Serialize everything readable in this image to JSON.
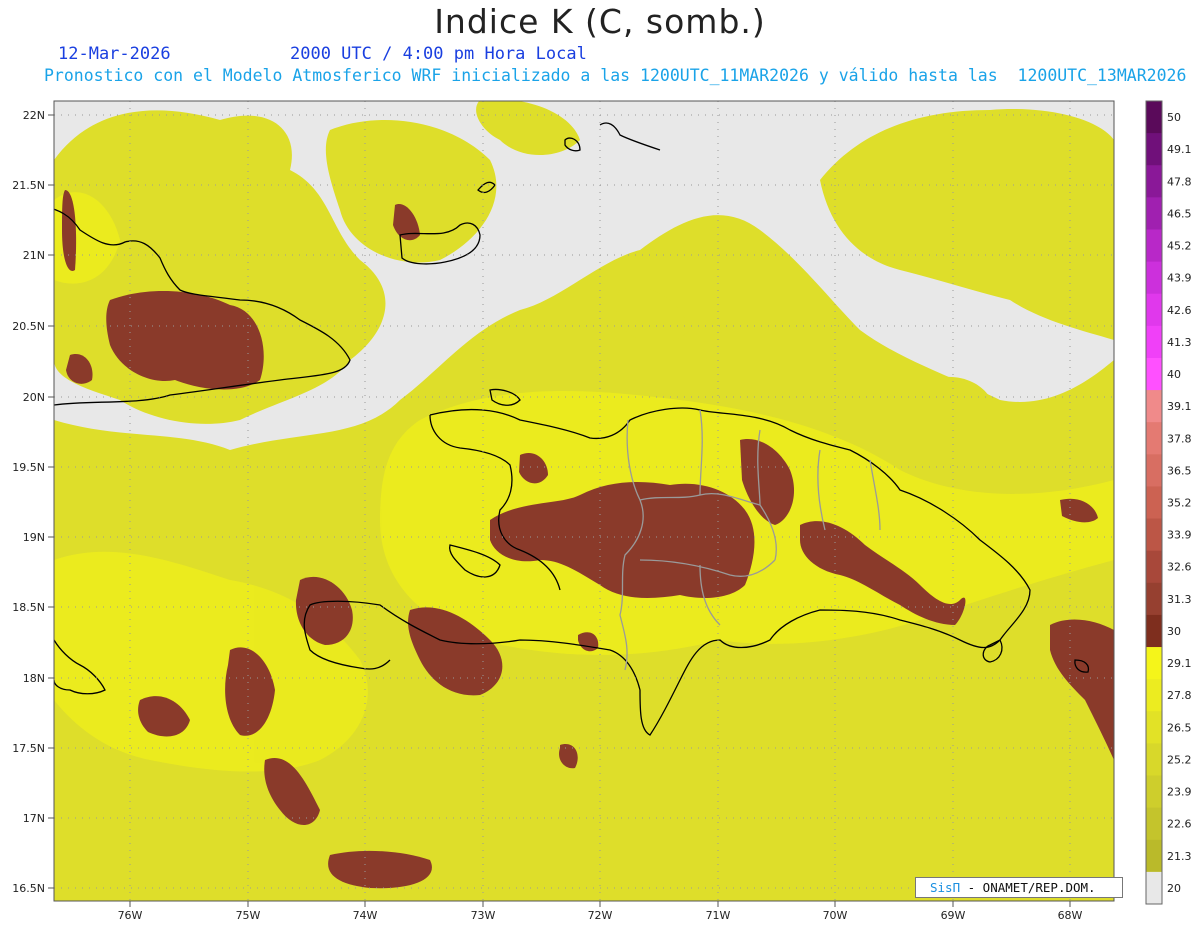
{
  "header": {
    "title": "Indice K (C, somb.)",
    "date": "12-Mar-2026",
    "time": "2000 UTC / 4:00 pm Hora Local",
    "subtitle": "Pronostico con el Modelo Atmosferico WRF inicializado a las 1200UTC_11MAR2026 y válido hasta las  1200UTC_13MAR2026"
  },
  "map": {
    "lat_labels": [
      "22N",
      "21.5N",
      "21N",
      "20.5N",
      "20N",
      "19.5N",
      "19N",
      "18.5N",
      "18N",
      "17.5N",
      "17N",
      "16.5N"
    ],
    "lon_labels": [
      "76W",
      "75W",
      "74W",
      "73W",
      "72W",
      "71W",
      "70W",
      "69W",
      "68W"
    ],
    "background_color": "#e8e8e8",
    "coastline_color": "#000000",
    "border_color": "#9a9a9a"
  },
  "colorbar": {
    "ticks": [
      "50",
      "49.1",
      "47.8",
      "46.5",
      "45.2",
      "43.9",
      "42.6",
      "41.3",
      "40",
      "39.1",
      "37.8",
      "36.5",
      "35.2",
      "33.9",
      "32.6",
      "31.3",
      "30",
      "29.1",
      "27.8",
      "26.5",
      "25.2",
      "23.9",
      "22.6",
      "21.3",
      "20"
    ],
    "colors": [
      "#5a0a5a",
      "#70107a",
      "#8a1898",
      "#a020b0",
      "#b828c8",
      "#cc30dc",
      "#e038ec",
      "#f040f8",
      "#ff50ff",
      "#f08a8a",
      "#e47a72",
      "#d86e62",
      "#cc6252",
      "#bc5646",
      "#a8483a",
      "#964030",
      "#7e2e1e",
      "#f5f51a",
      "#ecec20",
      "#e2e226",
      "#d8d82a",
      "#cece2c",
      "#c4c42c",
      "#baba2a",
      "#e8e8e8"
    ]
  },
  "credit": {
    "sis": "SisΠ",
    "org": " - ONAMET/REP.DOM."
  }
}
